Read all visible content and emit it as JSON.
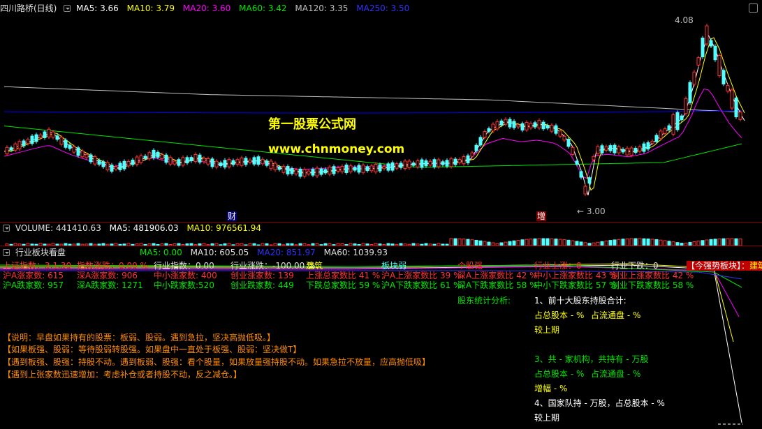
{
  "price_header": {
    "title": "四川路桥(日线)",
    "ma5": "MA5: 3.66",
    "ma10": "MA10: 3.79",
    "ma20": "MA20: 3.60",
    "ma60": "MA60: 3.42",
    "ma120": "MA120: 3.35",
    "ma250": "MA250: 3.50"
  },
  "price_chart": {
    "high_label": "4.08",
    "low_label": "3.00",
    "watermark_line1": "第一股票公式网",
    "watermark_line2": "www.chnmoney.com",
    "marker_cai": "财",
    "marker_zeng": "增"
  },
  "volume_header": {
    "volume": "VOLUME: 441410.63",
    "ma5": "MA5: 481906.03",
    "ma10": "MA10: 976561.94"
  },
  "indicator_header": {
    "title": "行业板块看盘",
    "ma5": "MA5: 0.00",
    "ma10": "MA10: 605.05",
    "ma20": "MA20: 851.97",
    "ma60": "MA60: 1039.93"
  },
  "indicator": {
    "row1": {
      "shanghai_index": "上证指数：3.1.30",
      "index_change": "指数涨跌：0.00 %",
      "industry_index": "行业指数：0.00",
      "industry_change": "行业涨跌：-100.00 %",
      "industry_name": "建筑",
      "board_weak": "板块弱",
      "stock_strong": "个股强",
      "industry_up": "行业上涨：0",
      "industry_down": "行业下跌：0",
      "strong_board_label": "【今强势板块】：",
      "strong_board_value": "建筑"
    },
    "row2": {
      "hu_a_up": "沪A涨家数: 615",
      "shen_a_up": "深A涨家数: 906",
      "zhongxiao_up": "中小涨家数: 400",
      "chuangye_up": "创业涨家数: 139",
      "up_ratio": "上涨总家数比 41 %",
      "hu_a_up_ratio": "沪A上涨家数比 39 %",
      "shen_a_up_ratio": "深A上涨家数比 42 %",
      "zhongxiao_up_ratio": "中小上涨家数比 43 %",
      "chuangye_up_ratio": "创业上涨家数比 42 %"
    },
    "row3": {
      "hu_a_down": "沪A跌家数: 957",
      "shen_a_down": "深A跌家数: 1271",
      "zhongxiao_down": "中小跌家数:520",
      "chuangye_down": "创业跌家数: 449",
      "down_ratio": "下跌总家数比 59 %",
      "hu_a_down_ratio": "沪A下跌家数比 61 %",
      "shen_a_down_ratio": "深A下跌家数比 58 %",
      "zhongxiao_down_ratio": "中小下跌家数比 57 %",
      "chuangye_down_ratio": "创业下跌家数比 58 %"
    },
    "shareholders": {
      "title": "股东统计分析:",
      "item1": "1、前十大股东持股合计:",
      "item1_share": "占总股本 - %",
      "item1_float": "占流通盘 - %",
      "item1_compare": "较上期",
      "item3": "3、共 - 家机构，共持有 - 万股",
      "item3_share": "占总股本 - %",
      "item3_float": "占流通盘 - %",
      "item3_growth": "增幅 - %",
      "item4": "4、国家队持 - 万股，占总股本 - %",
      "item4_compare": "较上期"
    },
    "notes": [
      "【说明：早盘如果持有的股票：板弱、股弱。遇到急拉，坚决高抛低吸。】",
      "【如果板强、股弱：等待股弱转股强。如果盘中一直处于板强、股弱：坚决做T】",
      "【遇到板强、股强：持股不动。遇到板弱、股强：看个股量，如果放量强持股不动。如果急拉不放量，应高抛低吸】",
      "【遇到上张家数迅速增加：考虑补仓或者持股不动，反之减仓。】"
    ]
  },
  "colors": {
    "up": "#ff3232",
    "down": "#54ffff",
    "ma5": "#ffffff",
    "ma10": "#ffff00",
    "ma20": "#ff00ff",
    "ma60": "#00e600",
    "ma120": "#c0c0c0",
    "ma250": "#0000ff",
    "separator": "#8b0000",
    "watermark": "#ffff00",
    "note_text": "#ff8c00"
  }
}
